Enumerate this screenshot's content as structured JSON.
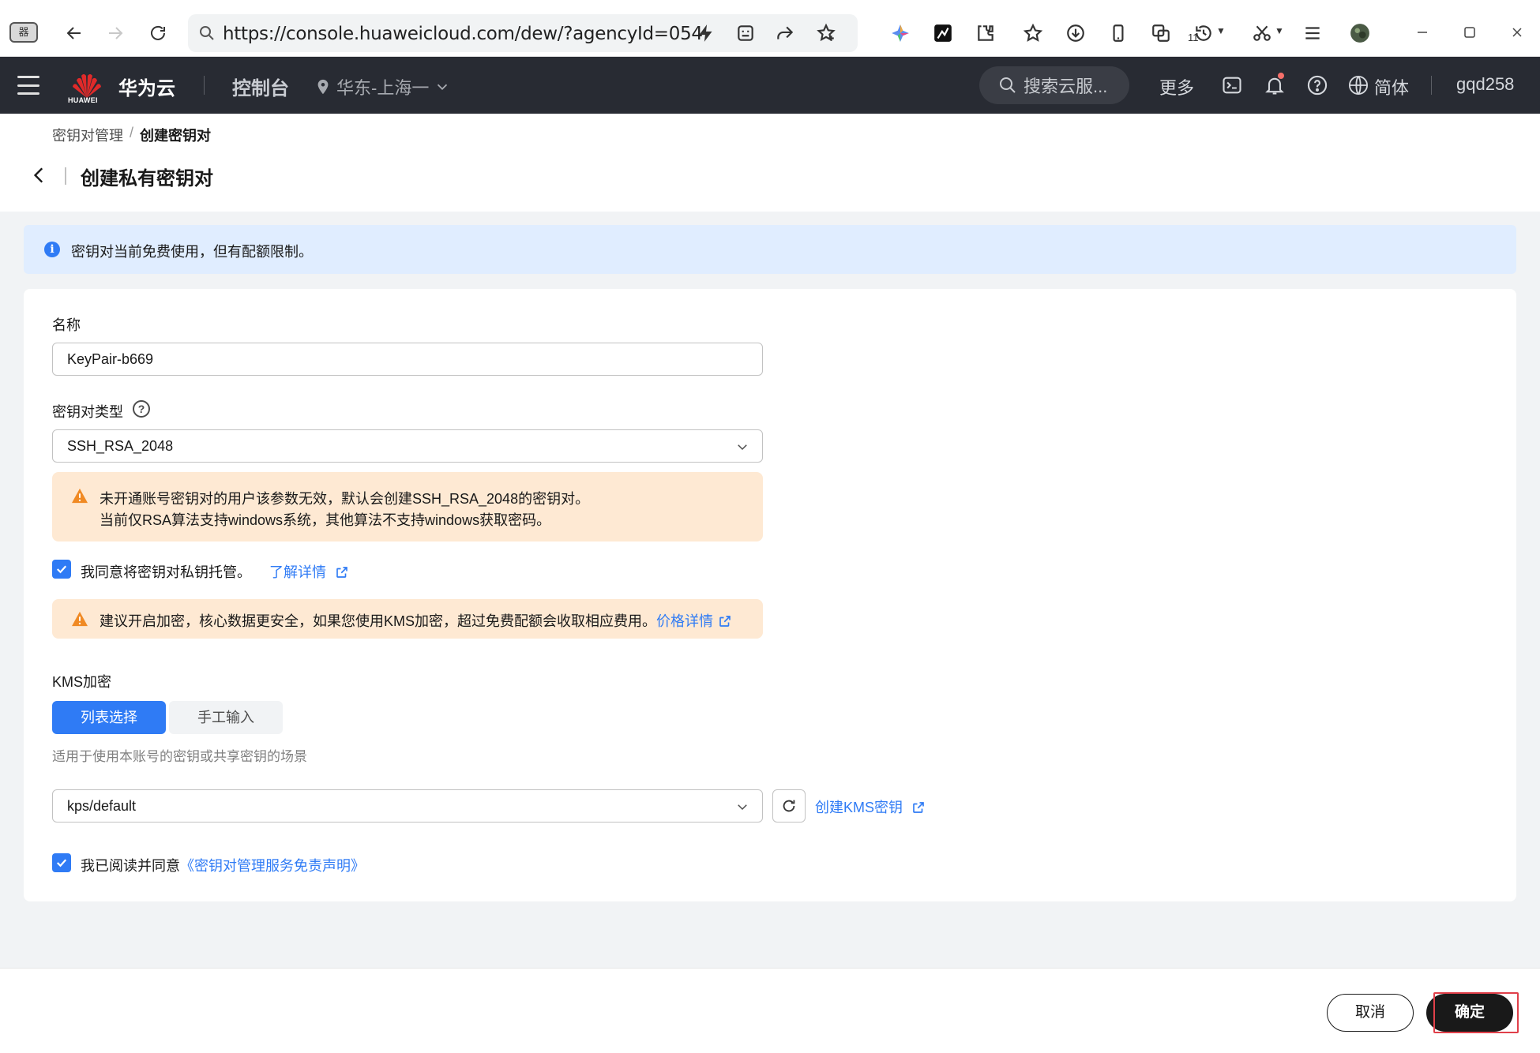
{
  "browser": {
    "tab_icon_text": "器",
    "url": "https://console.huaweicloud.com/dew/?agencyId=054",
    "extension_badge": "11"
  },
  "header": {
    "brand": "华为云",
    "logo_text": "HUAWEI",
    "console": "控制台",
    "region": "华东-上海一",
    "search_placeholder": "搜索云服...",
    "more": "更多",
    "language": "简体",
    "user": "gqd258"
  },
  "breadcrumb": {
    "parent": "密钥对管理",
    "separator": "/",
    "current": "创建密钥对"
  },
  "page_title": "创建私有密钥对",
  "info_banner": "密钥对当前免费使用，但有配额限制。",
  "form": {
    "name_label": "名称",
    "name_value": "KeyPair-b669",
    "type_label": "密钥对类型",
    "type_value": "SSH_RSA_2048",
    "type_warning_line1": "未开通账号密钥对的用户该参数无效，默认会创建SSH_RSA_2048的密钥对。",
    "type_warning_line2": "当前仅RSA算法支持windows系统，其他算法不支持windows获取密码。",
    "hosting_label": "我同意将密钥对私钥托管。",
    "hosting_link": "了解详情",
    "encrypt_warning": "建议开启加密，核心数据更安全，如果您使用KMS加密，超过免费配额会收取相应费用。",
    "encrypt_warning_link": "价格详情",
    "kms_label": "KMS加密",
    "kms_tab_list": "列表选择",
    "kms_tab_manual": "手工输入",
    "kms_hint": "适用于使用本账号的密钥或共享密钥的场景",
    "kms_value": "kps/default",
    "kms_create_link": "创建KMS密钥",
    "agree_label": "我已阅读并同意",
    "agree_link": "《密钥对管理服务免责声明》"
  },
  "footer": {
    "cancel": "取消",
    "confirm": "确定"
  },
  "colors": {
    "primary": "#2f7bf5",
    "header_bg": "#282b33",
    "warning_bg": "#fee9d3",
    "info_bg": "#e0edff"
  }
}
